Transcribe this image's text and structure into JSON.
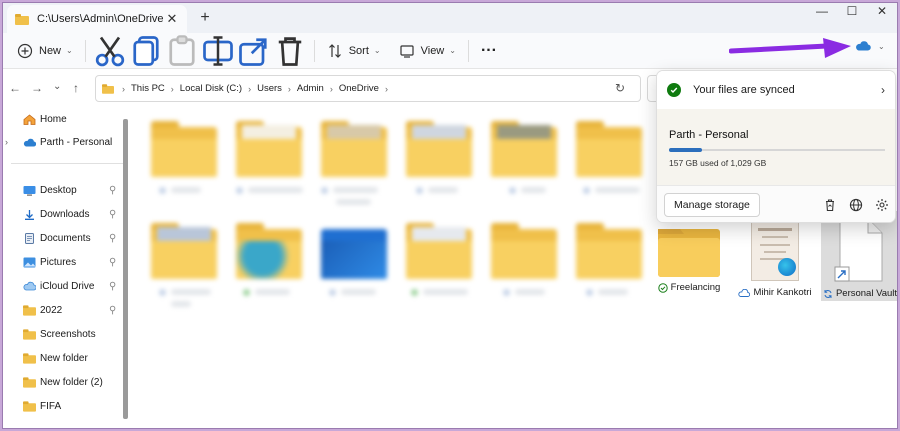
{
  "window": {
    "tab_title": "C:\\Users\\Admin\\OneDrive",
    "tab_close": "✕",
    "new_tab": "+",
    "minimize": "—",
    "maximize": "☐",
    "close": "✕"
  },
  "toolbar": {
    "new_label": "New",
    "sort_label": "Sort",
    "view_label": "View",
    "more_label": "···",
    "icons": [
      "cut-icon",
      "copy-icon",
      "paste-icon",
      "rename-icon",
      "share-icon",
      "delete-icon"
    ]
  },
  "address": {
    "back": "←",
    "forward": "→",
    "recent": "⌄",
    "up": "↑",
    "crumbs": [
      "This PC",
      "Local Disk (C:)",
      "Users",
      "Admin",
      "OneDrive"
    ],
    "crumb_sep": "›",
    "refresh": "↻"
  },
  "sidebar": {
    "items": [
      {
        "label": "Home",
        "icon": "home-icon",
        "pinned": false,
        "expander": ""
      },
      {
        "label": "Parth - Personal",
        "icon": "onedrive-cloud-icon",
        "pinned": false,
        "expander": "›"
      },
      {
        "label": "Desktop",
        "icon": "desktop-icon",
        "pinned": true,
        "expander": ""
      },
      {
        "label": "Downloads",
        "icon": "download-icon",
        "pinned": true,
        "expander": ""
      },
      {
        "label": "Documents",
        "icon": "documents-icon",
        "pinned": true,
        "expander": ""
      },
      {
        "label": "Pictures",
        "icon": "pictures-icon",
        "pinned": true,
        "expander": ""
      },
      {
        "label": "iCloud Drive",
        "icon": "icloud-icon",
        "pinned": true,
        "expander": ""
      },
      {
        "label": "2022",
        "icon": "folder-icon",
        "pinned": true,
        "expander": ""
      },
      {
        "label": "Screenshots",
        "icon": "folder-icon",
        "pinned": false,
        "expander": ""
      },
      {
        "label": "New folder",
        "icon": "folder-icon",
        "pinned": false,
        "expander": ""
      },
      {
        "label": "New folder (2)",
        "icon": "folder-icon",
        "pinned": false,
        "expander": ""
      },
      {
        "label": "FIFA",
        "icon": "folder-icon",
        "pinned": false,
        "expander": ""
      }
    ],
    "pin_glyph": "📌"
  },
  "files": {
    "visible": [
      {
        "name": "Freelancing",
        "type": "folder",
        "status": "synced-check-icon"
      },
      {
        "name": "Mihir Kankotri",
        "type": "document",
        "status": "cloud-only-icon"
      },
      {
        "name": "Personal Vault",
        "type": "shortcut",
        "status": "sync-pending-icon"
      }
    ]
  },
  "onedrive_flyout": {
    "status_text": "Your files are synced",
    "account_name": "Parth - Personal",
    "usage_text": "157 GB used of 1,029 GB",
    "usage_fraction": 0.153,
    "manage_storage": "Manage storage",
    "footer_icons": [
      "recycle-bin-icon",
      "globe-icon",
      "settings-gear-icon"
    ],
    "expand_arrow": "›"
  },
  "colors": {
    "annotation_arrow": "#8a2be2",
    "onedrive_blue": "#2c6fbd",
    "synced_green": "#0f7b0f",
    "folder_yellow": "#f8d061"
  }
}
